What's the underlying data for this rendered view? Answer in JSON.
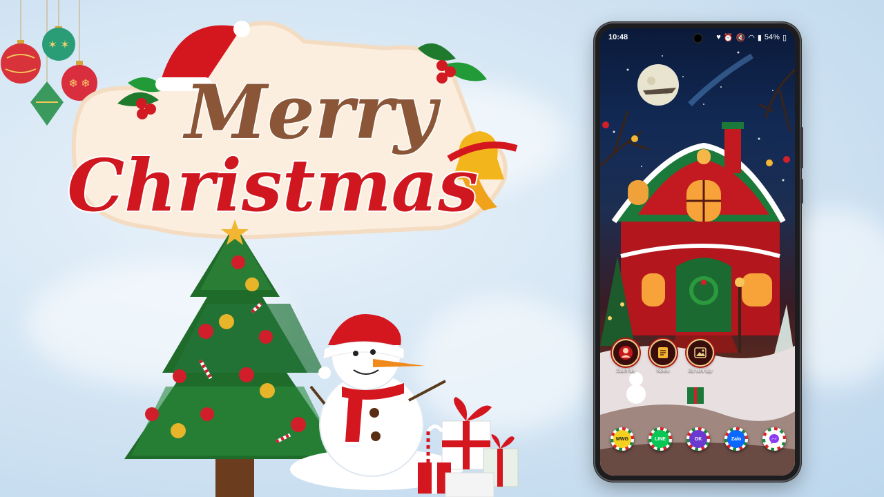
{
  "greeting": {
    "line1": "Merry",
    "line2": "Christmas"
  },
  "phone": {
    "status_bar": {
      "time": "10:48",
      "icons": [
        "heart-icon",
        "alarm-icon",
        "mute-icon",
        "wifi-icon",
        "signal-icon"
      ],
      "battery": "54%"
    },
    "apps": [
      {
        "label": "Danh bạ",
        "icon": "contacts-icon"
      },
      {
        "label": "Notes",
        "icon": "notes-icon"
      },
      {
        "label": "Bộ sưu tập",
        "icon": "gallery-icon"
      }
    ],
    "dock": [
      {
        "label": "MWG",
        "icon": "mwg-icon",
        "color": "#f5d020"
      },
      {
        "label": "LINE",
        "icon": "line-icon",
        "color": "#06c755"
      },
      {
        "label": "OK",
        "icon": "ok-icon",
        "color": "#6a3ad0"
      },
      {
        "label": "Zalo",
        "icon": "zalo-icon",
        "color": "#0a68ff"
      },
      {
        "label": "",
        "icon": "messenger-icon",
        "color": "#8a3cf5"
      }
    ]
  },
  "colors": {
    "background": "#d5e6f4",
    "christmas_red": "#c8161d",
    "pine_green": "#1f6b2a",
    "gold": "#f2b632"
  }
}
